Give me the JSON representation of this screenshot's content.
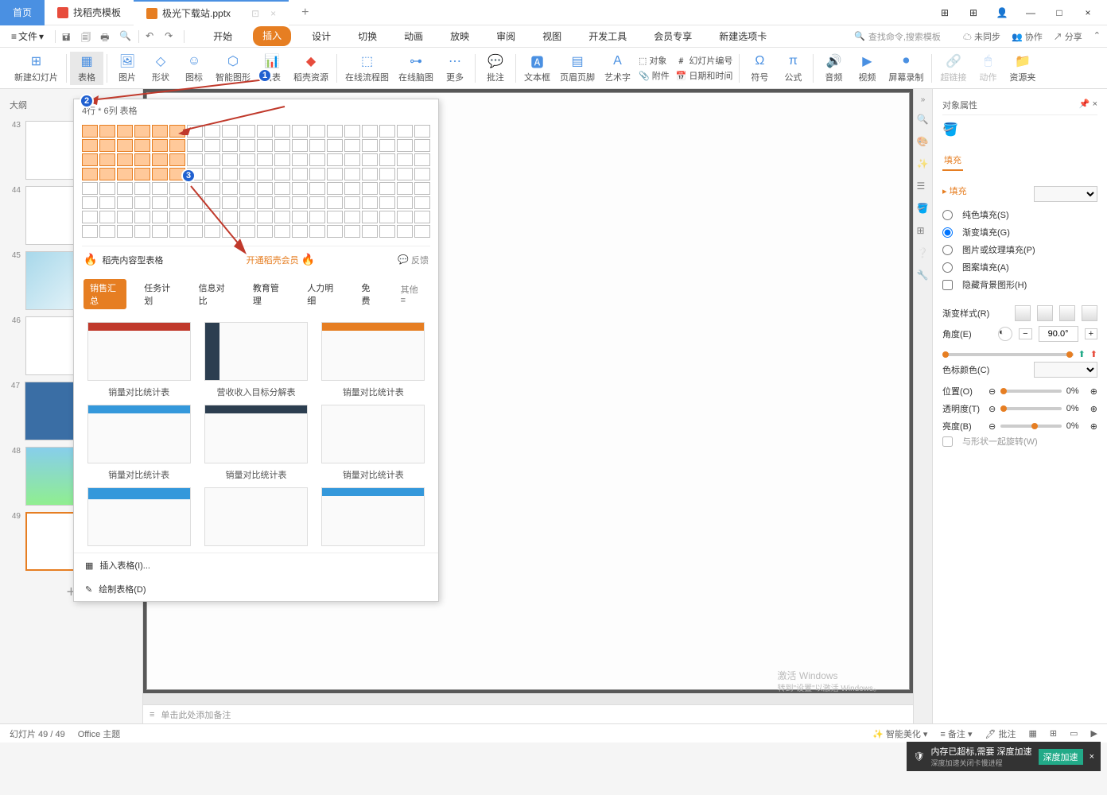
{
  "titlebar": {
    "home_tab": "首页",
    "tab1": "找稻壳模板",
    "tab2": "极光下载站.pptx",
    "add_tab": "+"
  },
  "menu": {
    "file": "文件"
  },
  "ribbon_tabs": [
    "开始",
    "插入",
    "设计",
    "切换",
    "动画",
    "放映",
    "审阅",
    "视图",
    "开发工具",
    "会员专享",
    "新建选项卡"
  ],
  "search": {
    "placeholder": "查找命令,搜索模板"
  },
  "top_right": {
    "sync": "未同步",
    "collab": "协作",
    "share": "分享"
  },
  "ribbon": {
    "new_slide": "新建幻灯片",
    "table": "表格",
    "picture": "图片",
    "shape": "形状",
    "icon": "图标",
    "smart": "智能图形",
    "chart": "图表",
    "docer": "稻壳资源",
    "flowchart": "在线流程图",
    "mindmap": "在线脑图",
    "more": "更多",
    "comment": "批注",
    "textbox": "文本框",
    "header": "页眉页脚",
    "wordart": "艺术字",
    "object": "对象",
    "attach": "附件",
    "slidenum": "幻灯片编号",
    "datetime": "日期和时间",
    "symbol": "符号",
    "equation": "公式",
    "audio": "音频",
    "video": "视频",
    "record": "屏幕录制",
    "hyperlink": "超链接",
    "action": "动作",
    "resource": "资源夹"
  },
  "table_popup": {
    "grid_label": "4行 * 6列 表格",
    "banner_title": "稻壳内容型表格",
    "vip_text": "开通稻壳会员",
    "feedback": "反馈",
    "tabs": [
      "销售汇总",
      "任务计划",
      "信息对比",
      "教育管理",
      "人力明细",
      "免费"
    ],
    "more_tab": "其他",
    "templates": [
      {
        "name": "销量对比统计表"
      },
      {
        "name": "营收收入目标分解表"
      },
      {
        "name": "销量对比统计表"
      },
      {
        "name": "销量对比统计表"
      },
      {
        "name": "销量对比统计表"
      },
      {
        "name": "销量对比统计表"
      }
    ],
    "insert_table": "插入表格(I)...",
    "draw_table": "绘制表格(D)"
  },
  "outline": {
    "tab1": "大纲",
    "slides": [
      "43",
      "44",
      "45",
      "46",
      "47",
      "48",
      "49"
    ]
  },
  "notes": {
    "placeholder": "单击此处添加备注"
  },
  "prop": {
    "title": "对象属性",
    "tab_fill": "填充",
    "section_fill": "填充",
    "fill_solid": "纯色填充(S)",
    "fill_gradient": "渐变填充(G)",
    "fill_picture": "图片或纹理填充(P)",
    "fill_pattern": "图案填充(A)",
    "hide_bg": "隐藏背景图形(H)",
    "grad_style": "渐变样式(R)",
    "angle": "角度(E)",
    "angle_val": "90.0°",
    "stop_color": "色标颜色(C)",
    "position": "位置(O)",
    "position_val": "0%",
    "transparency": "透明度(T)",
    "transparency_val": "0%",
    "brightness": "亮度(B)",
    "brightness_val": "0%",
    "rotate": "与形状一起旋转(W)"
  },
  "statusbar": {
    "slide_count": "幻灯片 49 / 49",
    "theme": "Office 主题",
    "beautify": "智能美化",
    "notes": "备注",
    "comments": "批注"
  },
  "watermark": {
    "line1": "激活 Windows",
    "line2": "转到\"设置\"以激活 Windows。"
  },
  "accel": {
    "mem": "内存已超标,需要 深度加速",
    "desc": "深度加速关闭卡慢进程",
    "btn": "深度加速"
  }
}
